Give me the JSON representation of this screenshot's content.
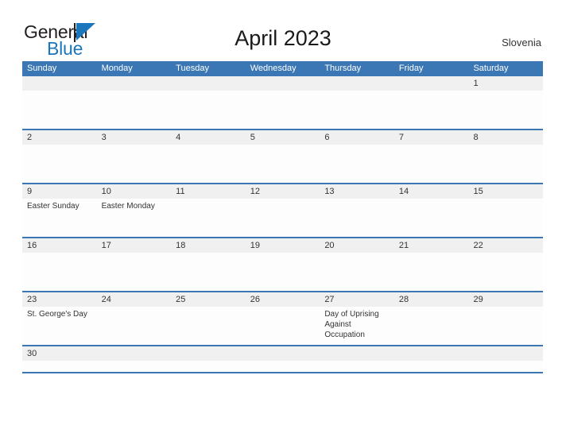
{
  "brand": {
    "name_part1": "General",
    "name_part2": "Blue",
    "sail_icon": "sail-triangle-icon"
  },
  "header": {
    "title": "April 2023",
    "country": "Slovenia"
  },
  "colors": {
    "header_blue": "#3b77b5",
    "date_band_gray": "#f0f0f0",
    "brand_blue": "#1c76bc",
    "text_dark": "#231f20"
  },
  "calendar": {
    "weekdays": [
      "Sunday",
      "Monday",
      "Tuesday",
      "Wednesday",
      "Thursday",
      "Friday",
      "Saturday"
    ],
    "weeks": [
      {
        "days": [
          {
            "date": "",
            "events": []
          },
          {
            "date": "",
            "events": []
          },
          {
            "date": "",
            "events": []
          },
          {
            "date": "",
            "events": []
          },
          {
            "date": "",
            "events": []
          },
          {
            "date": "",
            "events": []
          },
          {
            "date": "1",
            "events": []
          }
        ]
      },
      {
        "days": [
          {
            "date": "2",
            "events": []
          },
          {
            "date": "3",
            "events": []
          },
          {
            "date": "4",
            "events": []
          },
          {
            "date": "5",
            "events": []
          },
          {
            "date": "6",
            "events": []
          },
          {
            "date": "7",
            "events": []
          },
          {
            "date": "8",
            "events": []
          }
        ]
      },
      {
        "days": [
          {
            "date": "9",
            "events": [
              "Easter Sunday"
            ]
          },
          {
            "date": "10",
            "events": [
              "Easter Monday"
            ]
          },
          {
            "date": "11",
            "events": []
          },
          {
            "date": "12",
            "events": []
          },
          {
            "date": "13",
            "events": []
          },
          {
            "date": "14",
            "events": []
          },
          {
            "date": "15",
            "events": []
          }
        ]
      },
      {
        "days": [
          {
            "date": "16",
            "events": []
          },
          {
            "date": "17",
            "events": []
          },
          {
            "date": "18",
            "events": []
          },
          {
            "date": "19",
            "events": []
          },
          {
            "date": "20",
            "events": []
          },
          {
            "date": "21",
            "events": []
          },
          {
            "date": "22",
            "events": []
          }
        ]
      },
      {
        "days": [
          {
            "date": "23",
            "events": [
              "St. George's Day"
            ]
          },
          {
            "date": "24",
            "events": []
          },
          {
            "date": "25",
            "events": []
          },
          {
            "date": "26",
            "events": []
          },
          {
            "date": "27",
            "events": [
              "Day of Uprising",
              "Against Occupation"
            ]
          },
          {
            "date": "28",
            "events": []
          },
          {
            "date": "29",
            "events": []
          }
        ]
      },
      {
        "short": true,
        "days": [
          {
            "date": "30",
            "events": []
          },
          {
            "date": "",
            "events": []
          },
          {
            "date": "",
            "events": []
          },
          {
            "date": "",
            "events": []
          },
          {
            "date": "",
            "events": []
          },
          {
            "date": "",
            "events": []
          },
          {
            "date": "",
            "events": []
          }
        ]
      }
    ]
  }
}
